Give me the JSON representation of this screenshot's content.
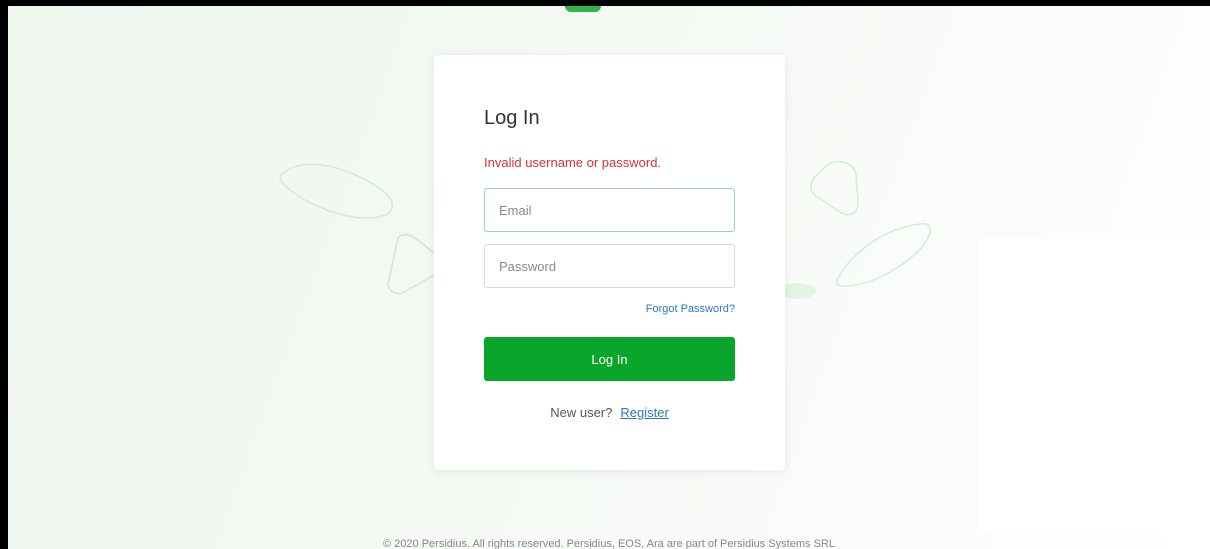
{
  "login": {
    "title": "Log In",
    "error": "Invalid username or password.",
    "email_placeholder": "Email",
    "password_placeholder": "Password",
    "forgot_password": "Forgot Password?",
    "submit_label": "Log In",
    "new_user_text": "New user?",
    "register_link": "Register"
  },
  "footer": {
    "text": "© 2020 Persidius. All rights reserved. Persidius, EOS, Ara are part of Persidius Systems SRL"
  },
  "colors": {
    "primary_button": "#0aa62b",
    "error_text": "#d9303a",
    "link": "#2b78c2",
    "accent_tab": "#2fb34a"
  }
}
